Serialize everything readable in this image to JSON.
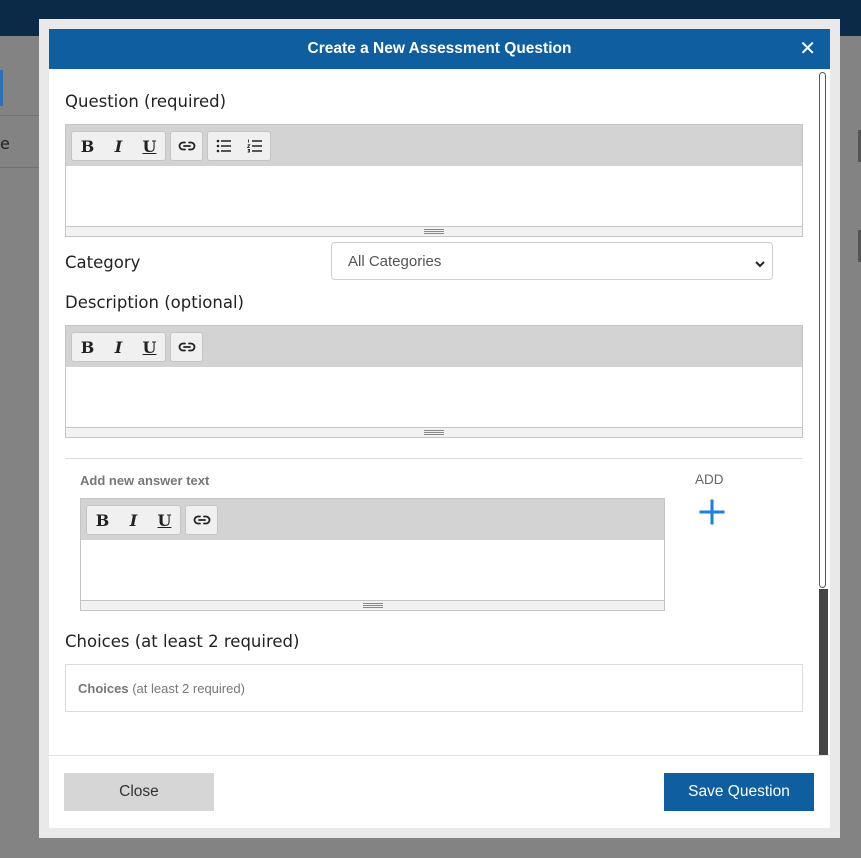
{
  "background": {
    "partial_text": "e"
  },
  "modal": {
    "title": "Create a New Assessment Question",
    "close_glyph": "✕"
  },
  "form": {
    "question_label": "Question (required)",
    "category_label": "Category",
    "category_value": "All Categories",
    "description_label": "Description (optional)",
    "answer_label": "Add new answer text",
    "add_label": "ADD",
    "choices_label": "Choices (at least 2 required)",
    "choices_box_bold": "Choices",
    "choices_box_rest": " (at least 2 required)"
  },
  "toolbar": {
    "bold": "B",
    "italic": "I",
    "underline": "U"
  },
  "footer": {
    "close_label": "Close",
    "save_label": "Save Question"
  },
  "colors": {
    "header": "#0e5ea0",
    "primary_button": "#0e5ea0",
    "add_icon": "#1a7fe0",
    "overlay": "#838383"
  },
  "icons": [
    "link-icon",
    "bullet-list-icon",
    "numbered-list-icon",
    "plus-icon",
    "chevron-down-icon",
    "close-icon"
  ]
}
